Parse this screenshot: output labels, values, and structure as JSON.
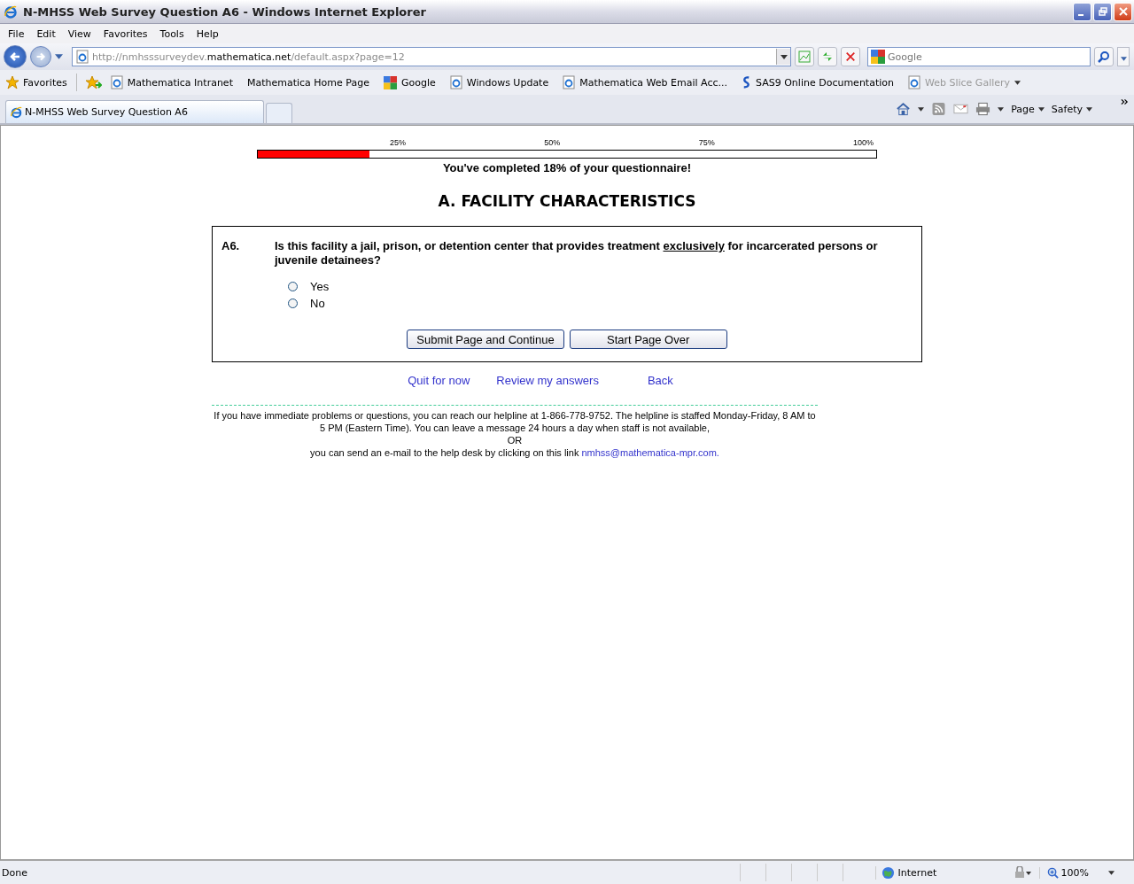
{
  "window": {
    "title": "N-MHSS Web Survey Question A6 - Windows Internet Explorer"
  },
  "menu": [
    "File",
    "Edit",
    "View",
    "Favorites",
    "Tools",
    "Help"
  ],
  "address": {
    "prefix": "http://nmhsssurveydev.",
    "domain": "mathematica.net",
    "path": "/default.aspx?page=12"
  },
  "search": {
    "placeholder": "Google"
  },
  "favorites": {
    "label": "Favorites",
    "items": [
      {
        "label": "Mathematica Intranet",
        "kind": "ie",
        "disabled": false
      },
      {
        "label": "Mathematica Home Page",
        "kind": "none",
        "disabled": false
      },
      {
        "label": "Google",
        "kind": "google",
        "disabled": false
      },
      {
        "label": "Windows Update",
        "kind": "ie",
        "disabled": false
      },
      {
        "label": "Mathematica Web Email Acc...",
        "kind": "ie",
        "disabled": false
      },
      {
        "label": "SAS9 Online Documentation",
        "kind": "sas",
        "disabled": false
      },
      {
        "label": "Web Slice Gallery",
        "kind": "ie",
        "disabled": true
      }
    ]
  },
  "tab": {
    "label": "N-MHSS Web Survey Question A6",
    "selected": true
  },
  "commands": [
    "Page",
    "Safety"
  ],
  "progress": {
    "ticks": [
      "25%",
      "50%",
      "75%",
      "100%"
    ],
    "level": 0.18,
    "caption": "You've completed 18% of your questionnaire!"
  },
  "section_title": "A. FACILITY CHARACTERISTICS",
  "question": {
    "number": "A6.",
    "text_before": "Is this facility a jail, prison, or detention center that provides treatment ",
    "emphasis": "exclusively",
    "text_after": " for incarcerated persons or juvenile detainees?",
    "options": [
      {
        "label": "Yes",
        "selected": false
      },
      {
        "label": "No",
        "selected": false
      }
    ]
  },
  "buttons": [
    "Submit Page and Continue",
    "Start Page Over"
  ],
  "links": [
    "Quit for now",
    "Review my answers",
    "Back"
  ],
  "help": {
    "lines": [
      "If you have immediate problems or questions, you can reach our helpline at 1-866-778-9752. The helpline is staffed Monday-Friday, 8 AM to 5 PM (Eastern Time). You can leave a message 24 hours a day when staff is not available,",
      "OR"
    ],
    "email_intro": "you can send an e-mail to the help desk by clicking on this link",
    "email": "nmhss@mathematica-mpr.com."
  },
  "status_bar": {
    "text": "Done",
    "zone": "Internet",
    "zoom": "100%"
  }
}
